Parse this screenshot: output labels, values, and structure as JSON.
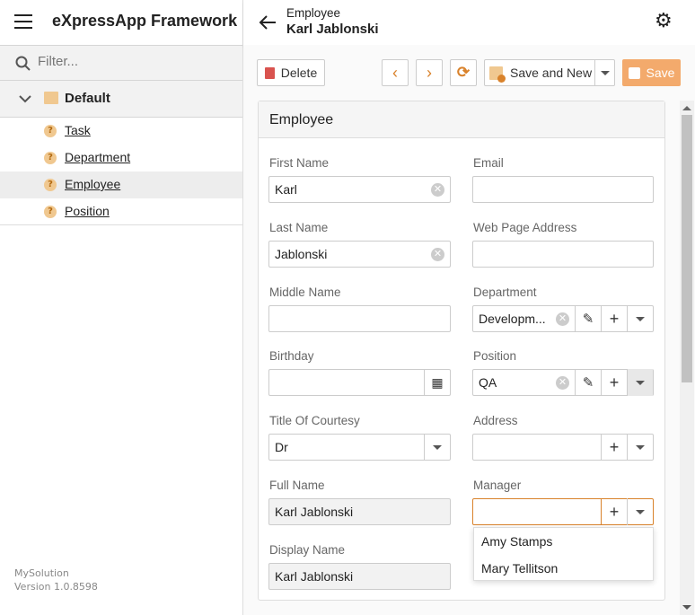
{
  "app": {
    "title": "eXpressApp Framework",
    "menu_icon": "hamburger-icon"
  },
  "sidebar": {
    "filter_placeholder": "Filter...",
    "group": "Default",
    "items": [
      {
        "label": "Task"
      },
      {
        "label": "Department"
      },
      {
        "label": "Employee",
        "selected": true
      },
      {
        "label": "Position"
      }
    ],
    "footer": {
      "name": "MySolution",
      "version": "Version 1.0.8598"
    }
  },
  "header": {
    "subtitle": "Employee",
    "title": "Karl Jablonski"
  },
  "toolbar": {
    "delete": "Delete",
    "save_and_new": "Save and New",
    "save": "Save"
  },
  "colors": {
    "accent": "#d9822b",
    "save_button": "#f3aa6c",
    "delete_icon": "#d9534f"
  },
  "form": {
    "title": "Employee",
    "fields": {
      "first_name": {
        "label": "First Name",
        "value": "Karl"
      },
      "last_name": {
        "label": "Last Name",
        "value": "Jablonski"
      },
      "middle_name": {
        "label": "Middle Name",
        "value": ""
      },
      "birthday": {
        "label": "Birthday",
        "value": ""
      },
      "title_of_courtesy": {
        "label": "Title Of Courtesy",
        "value": "Dr"
      },
      "full_name": {
        "label": "Full Name",
        "value": "Karl Jablonski"
      },
      "display_name": {
        "label": "Display Name",
        "value": "Karl Jablonski"
      },
      "email": {
        "label": "Email",
        "value": ""
      },
      "web_page": {
        "label": "Web Page Address",
        "value": ""
      },
      "department": {
        "label": "Department",
        "value": "Developm..."
      },
      "position": {
        "label": "Position",
        "value": "QA"
      },
      "address": {
        "label": "Address",
        "value": ""
      },
      "manager": {
        "label": "Manager",
        "value": ""
      }
    },
    "manager_options": [
      "Amy Stamps",
      "Mary Tellitson"
    ]
  }
}
